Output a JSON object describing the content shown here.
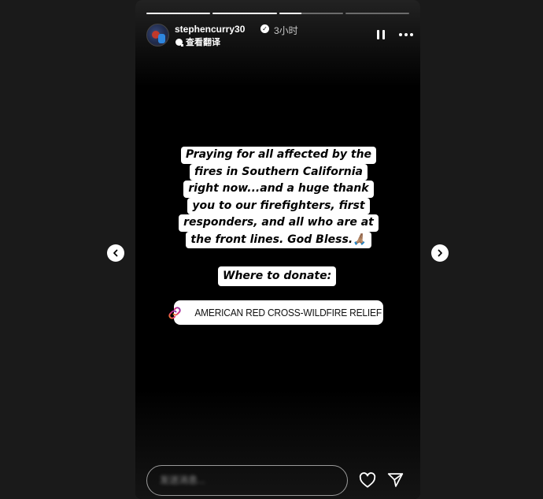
{
  "story": {
    "progress": [
      1,
      1,
      0.35,
      0
    ],
    "user": {
      "username": "stephencurry30",
      "verified_icon": "✓",
      "time_ago": "3小时",
      "translate_label": "查看翻译"
    },
    "caption_lines": [
      "Praying for all affected by the",
      "fires in Southern California",
      "right now...and a huge thank",
      "you to our firefighters, first",
      "responders, and all who are at",
      "the front lines. God Bless.🙏🏽"
    ],
    "donate_label": "Where to donate:",
    "link_sticker": {
      "text": "AMERICAN RED CROSS-WILDFIRE RELIEF",
      "icon": "link-icon"
    }
  },
  "reply": {
    "placeholder": "发送消息..."
  },
  "icons": {
    "pause": "pause-icon",
    "more": "more-options-icon",
    "prev": "chevron-left-icon",
    "next": "chevron-right-icon",
    "like": "heart-icon",
    "share": "send-icon"
  },
  "colors": {
    "background": "#1a1a1a",
    "story_bg": "#000000",
    "sticker_bg": "#ffffff",
    "link_gradient": [
      "#f58529",
      "#dd2a7b",
      "#8134af"
    ]
  }
}
